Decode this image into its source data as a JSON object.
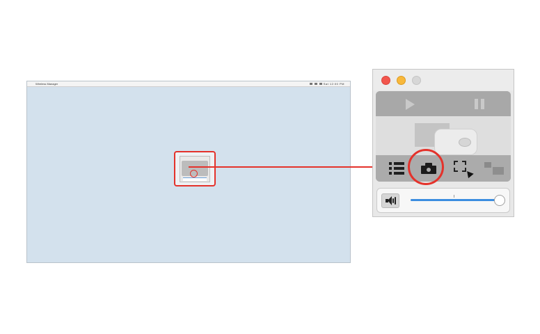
{
  "desktop": {
    "menubar": {
      "apple_glyph": "",
      "app_name": "Wireless Manager",
      "status_text": "Sat 12:00 PM"
    }
  },
  "colors": {
    "highlight": "#e4322b",
    "desktop_bg": "#d3e1ed",
    "slider_fill": "#3b8de0"
  },
  "app_window": {
    "traffic_lights": [
      "close",
      "minimize",
      "maximize"
    ],
    "controls": {
      "play_icon": "play-icon",
      "pause_icon": "pause-icon"
    },
    "toolbar_icons": [
      "list-icon",
      "camera-icon",
      "region-capture-icon",
      "window-capture-icon"
    ],
    "selected_tool": "camera-icon",
    "volume": {
      "icon": "speaker-icon",
      "level": 1.0
    }
  }
}
